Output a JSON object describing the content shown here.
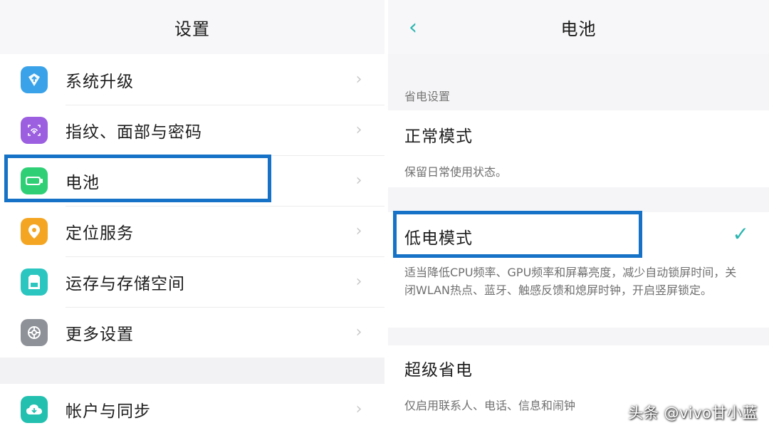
{
  "left": {
    "title": "设置",
    "items": [
      {
        "label": "系统升级",
        "icon": "update-icon",
        "color": "#3aa2e8"
      },
      {
        "label": "指纹、面部与密码",
        "icon": "fingerprint-icon",
        "color": "#9b5fe0"
      },
      {
        "label": "电池",
        "icon": "battery-icon",
        "color": "#2fcf76"
      },
      {
        "label": "定位服务",
        "icon": "location-icon",
        "color": "#f4a623"
      },
      {
        "label": "运存与存储空间",
        "icon": "storage-icon",
        "color": "#2cc6c0"
      },
      {
        "label": "更多设置",
        "icon": "gear-icon",
        "color": "#8e9198"
      },
      {
        "label": "帐户与同步",
        "icon": "cloud-sync-icon",
        "color": "#23c0b0"
      }
    ],
    "chevron": "›"
  },
  "right": {
    "title": "电池",
    "back": "‹",
    "section": "省电设置",
    "modes": [
      {
        "name": "正常模式",
        "desc": "保留日常使用状态。"
      },
      {
        "name": "低电模式",
        "desc": "适当降低CPU频率、GPU频率和屏幕亮度，减少自动锁屏时间，关闭WLAN热点、蓝牙、触感反馈和熄屏时钟，开启竖屏锁定。",
        "selected": true
      },
      {
        "name": "超级省电",
        "desc": "仅启用联系人、电话、信息和闹钟"
      }
    ],
    "check": "✓"
  },
  "watermark": "头条 @vivo甘小蓝",
  "highlight_color": "#1672c6",
  "accent_color": "#2bb5b0"
}
